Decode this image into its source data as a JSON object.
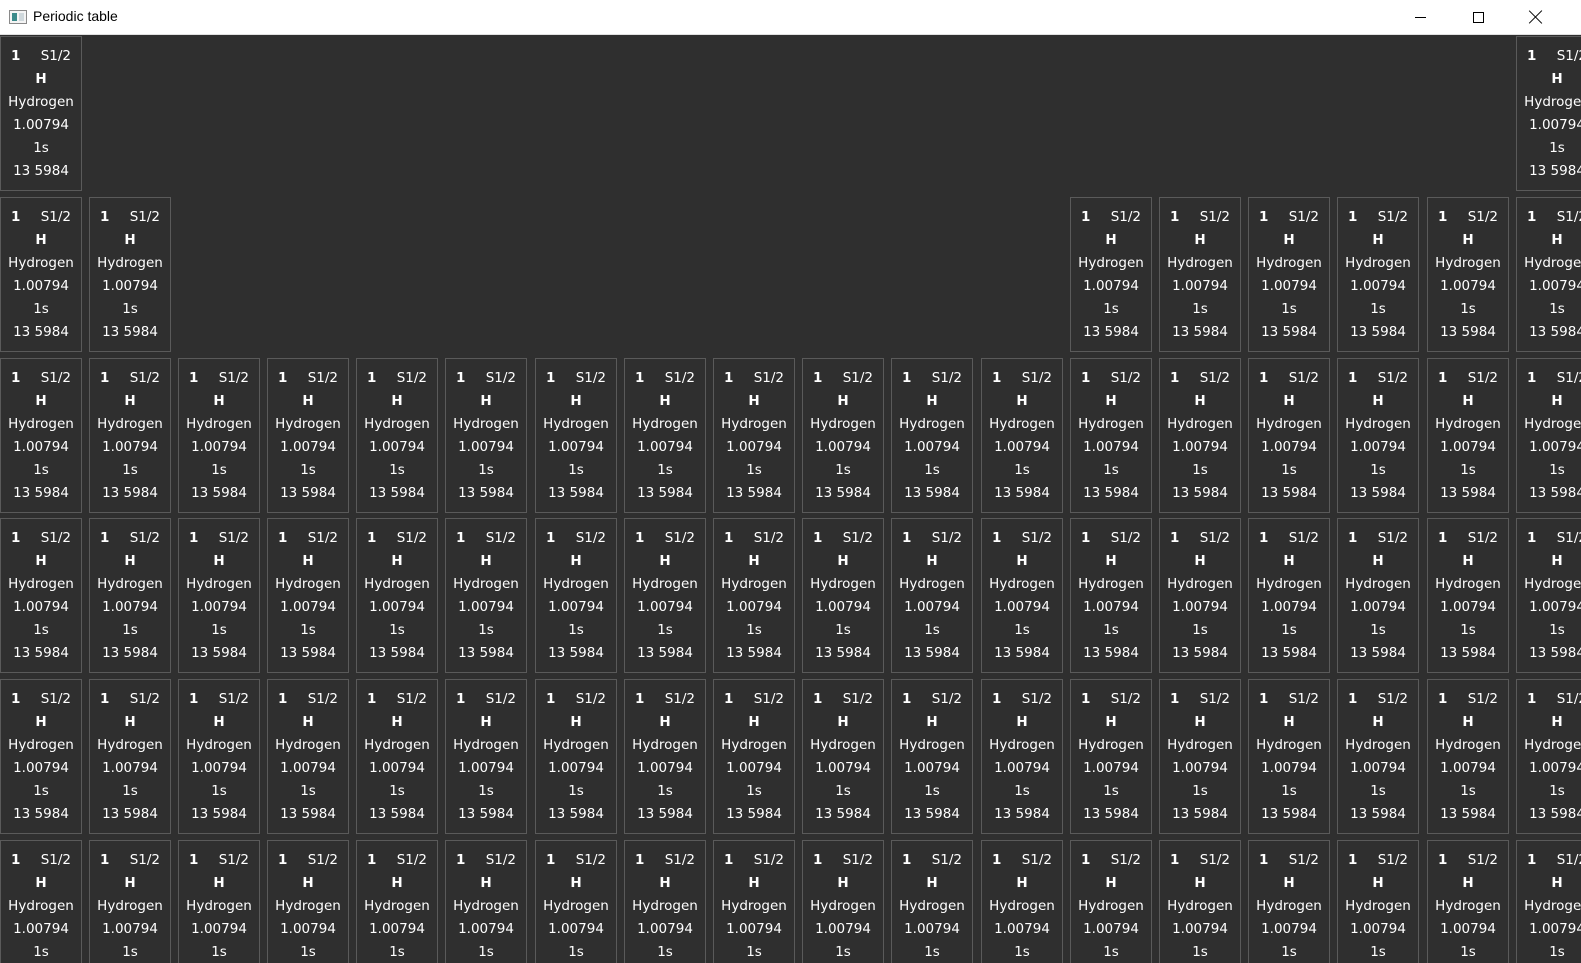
{
  "window": {
    "title": "Periodic table",
    "controls": {
      "minimize": "minimize-icon",
      "maximize": "maximize-icon",
      "close": "close-icon"
    }
  },
  "element": {
    "number": "1",
    "term": "S1/2",
    "symbol": "H",
    "name": "Hydrogen",
    "mass": "1.00794",
    "config": "1s",
    "ionization": "13 5984"
  },
  "colors": {
    "background": "#2f2f2f",
    "cell_border": "#5a5a5a",
    "text": "#ffffff",
    "titlebar": "#ffffff"
  }
}
